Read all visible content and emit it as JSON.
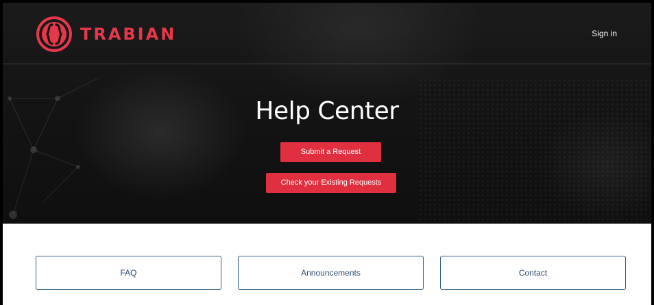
{
  "brand": {
    "name": "TRABIAN",
    "accent_color": "#e6374b",
    "logo_icon": "trabian-logo-icon"
  },
  "header": {
    "sign_in_label": "Sign in"
  },
  "hero": {
    "title": "Help Center",
    "submit_request_label": "Submit a Request",
    "check_requests_label": "Check your Existing Requests",
    "button_color": "#e0303f"
  },
  "cards": {
    "faq_label": "FAQ",
    "announcements_label": "Announcements",
    "contact_label": "Contact",
    "border_color": "#2e5b87"
  }
}
